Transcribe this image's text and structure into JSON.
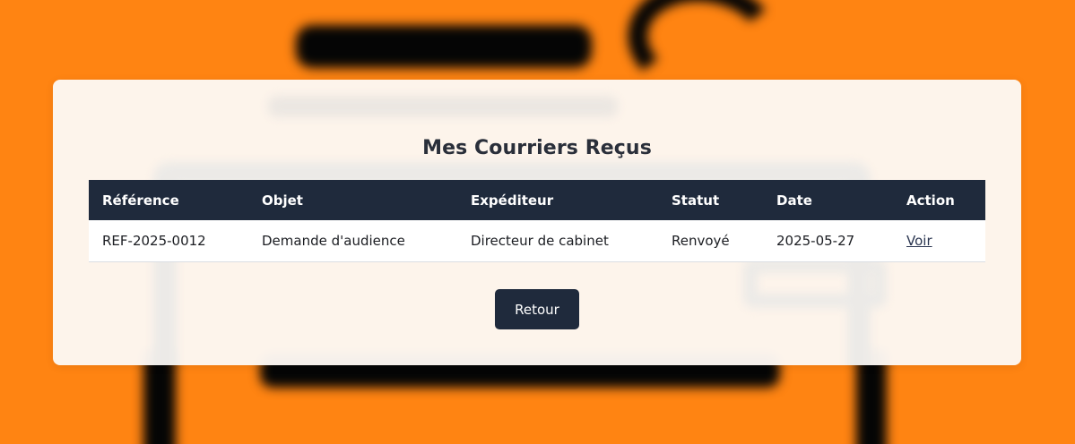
{
  "page": {
    "title": "Mes Courriers Reçus"
  },
  "table": {
    "headers": [
      "Référence",
      "Objet",
      "Expéditeur",
      "Statut",
      "Date",
      "Action"
    ],
    "rows": [
      {
        "reference": "REF-2025-0012",
        "objet": "Demande d'audience",
        "expediteur": "Directeur de cabinet",
        "statut": "Renvoyé",
        "date": "2025-05-27",
        "action": "Voir"
      }
    ]
  },
  "actions": {
    "back_label": "Retour"
  },
  "colors": {
    "background": "#ff8412",
    "card": "#fdf8f3",
    "header": "#1f2a3c",
    "button": "#1f2a3c"
  }
}
